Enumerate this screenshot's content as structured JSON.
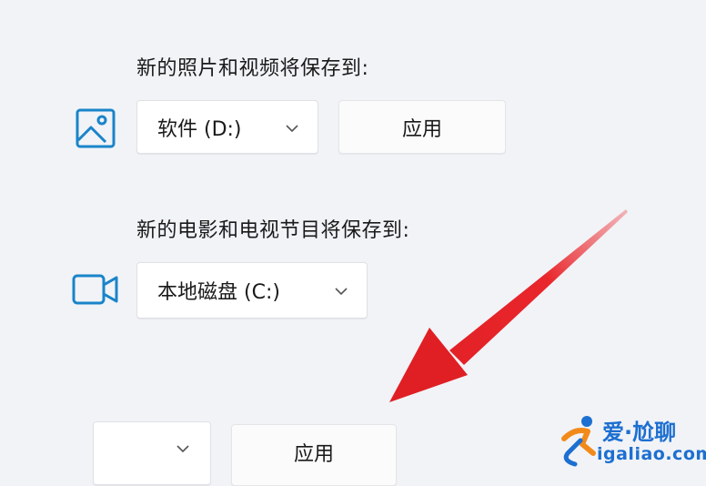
{
  "photos_section": {
    "label": "新的照片和视频将保存到:",
    "icon": "image-icon",
    "dropdown_value": "软件 (D:)",
    "apply_label": "应用"
  },
  "movies_section": {
    "label": "新的电影和电视节目将保存到:",
    "icon": "video-camera-icon",
    "dropdown_value": "本地磁盘 (C:)"
  },
  "bottom_section": {
    "dropdown_value": "",
    "apply_label": "应用"
  },
  "annotation": {
    "arrow_color": "#e8262b"
  },
  "watermark": {
    "line1": "爱·尬聊",
    "line2": "igaliao.com"
  },
  "colors": {
    "icon_blue": "#1a84c9",
    "background": "#f1f3f7"
  }
}
